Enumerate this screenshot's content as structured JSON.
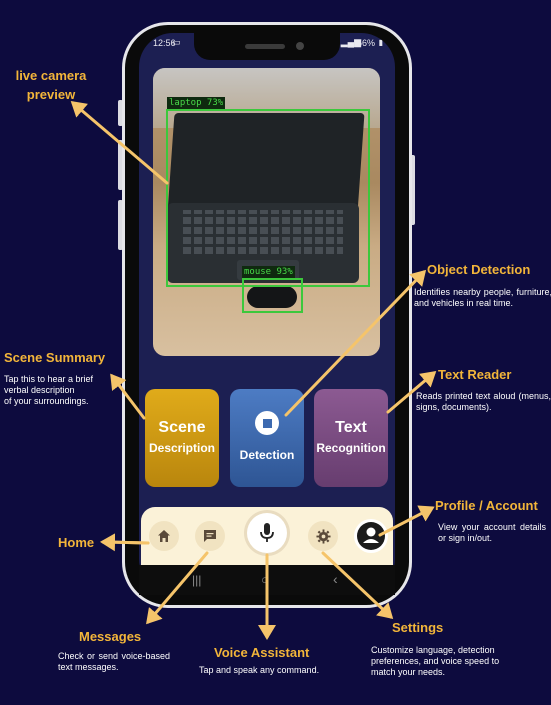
{
  "status_bar": {
    "time": "12:56",
    "battery": "56%"
  },
  "detections": [
    {
      "label": "laptop 73%"
    },
    {
      "label": "mouse 93%"
    }
  ],
  "modes": {
    "scene": {
      "line1": "Scene",
      "line2": "Description"
    },
    "detection": {
      "line1": "Detection"
    },
    "text": {
      "line1": "Text",
      "line2": "Recognition"
    }
  },
  "nav": {
    "home": "home-icon",
    "messages": "message-icon",
    "voice": "microphone-icon",
    "settings": "gear-icon",
    "profile": "profile-icon"
  },
  "annotations": {
    "live_camera": "live camera\npreview",
    "object_detection": {
      "title": "Object Detection",
      "desc": "Identifies nearby people, furniture, and vehicles in real time."
    },
    "scene_summary": {
      "title": "Scene Summary",
      "desc": "Tap this to hear a brief verbal description\n of your surroundings."
    },
    "text_reader": {
      "title": "Text Reader",
      "desc": "Reads printed text aloud (menus, signs, documents)."
    },
    "profile_account": {
      "title": "Profile / Account",
      "desc": "View your account details or sign in/out."
    },
    "home": {
      "title": "Home"
    },
    "messages": {
      "title": "Messages",
      "desc": "Check or send voice-based text messages."
    },
    "voice_assistant": {
      "title": "Voice Assistant",
      "desc": "Tap and speak any command."
    },
    "settings": {
      "title": "Settings",
      "desc": "Customize language, detection preferences, and voice speed to match your needs."
    }
  },
  "colors": {
    "background": "#0d0b3e",
    "accent": "#f2b53a",
    "arrow": "#f5c46a",
    "scene_button": "#d4a017",
    "detection_button": "#3d6ab0",
    "text_button": "#7a4a82",
    "navbar": "#fbf2d8"
  }
}
